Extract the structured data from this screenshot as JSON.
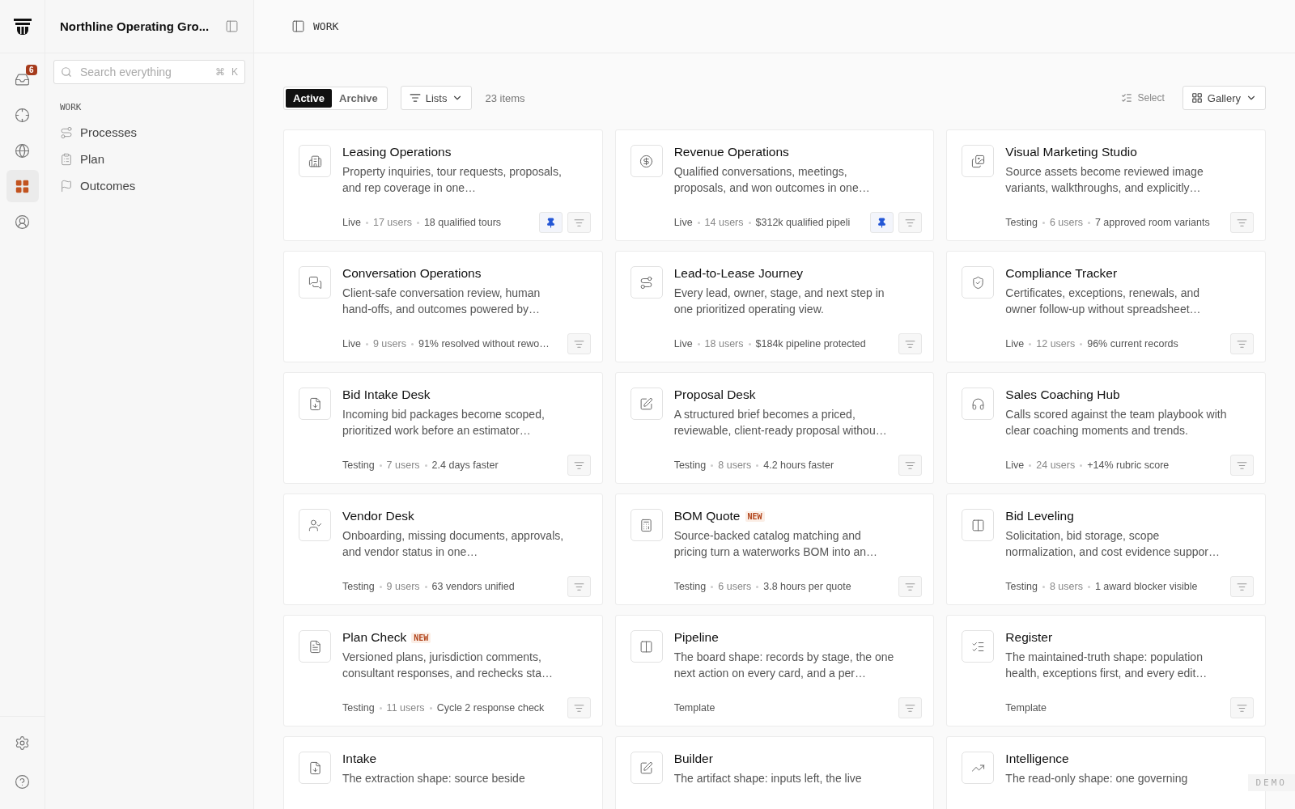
{
  "workspace": {
    "name": "Northline Operating Gro..."
  },
  "rail": {
    "items": [
      {
        "selected": false,
        "badge": "6"
      },
      {
        "selected": false
      },
      {
        "selected": false
      },
      {
        "selected": true
      },
      {
        "selected": false
      }
    ]
  },
  "search": {
    "placeholder": "Search everything",
    "shortcut": [
      "⌘",
      "K"
    ]
  },
  "sidebar": {
    "section": "WORK",
    "items": [
      {
        "label": "Processes"
      },
      {
        "label": "Plan"
      },
      {
        "label": "Outcomes"
      }
    ]
  },
  "header": {
    "title": "WORK"
  },
  "toolbar": {
    "tabs": [
      {
        "label": "Active",
        "selected": true
      },
      {
        "label": "Archive",
        "selected": false
      }
    ],
    "lists": "Lists",
    "count": "23 items",
    "select": "Select",
    "view": "Gallery"
  },
  "cards": [
    {
      "title": "Leasing Operations",
      "description": "Property inquiries, tour requests, proposals, and rep coverage in one…",
      "status": "Live",
      "users": "17 users",
      "metric": "18 qualified tours",
      "pinned": true
    },
    {
      "title": "Revenue Operations",
      "description": "Qualified conversations, meetings, proposals, and won outcomes in one…",
      "status": "Live",
      "users": "14 users",
      "metric": "$312k qualified pipeli",
      "pinned": true
    },
    {
      "title": "Visual Marketing Studio",
      "description": "Source assets become reviewed image variants, walkthroughs, and explicitly…",
      "status": "Testing",
      "users": "6 users",
      "metric": "7 approved room variants",
      "pinned": false
    },
    {
      "title": "Conversation Operations",
      "description": "Client-safe conversation review, human hand-offs, and outcomes powered by…",
      "status": "Live",
      "users": "9 users",
      "metric": "91% resolved without rewo…",
      "pinned": false
    },
    {
      "title": "Lead-to-Lease Journey",
      "description": "Every lead, owner, stage, and next step in one prioritized operating view.",
      "status": "Live",
      "users": "18 users",
      "metric": "$184k pipeline protected",
      "pinned": false
    },
    {
      "title": "Compliance Tracker",
      "description": "Certificates, exceptions, renewals, and owner follow-up without spreadsheet…",
      "status": "Live",
      "users": "12 users",
      "metric": "96% current records",
      "pinned": false
    },
    {
      "title": "Bid Intake Desk",
      "description": "Incoming bid packages become scoped, prioritized work before an estimator…",
      "status": "Testing",
      "users": "7 users",
      "metric": "2.4 days faster",
      "pinned": false
    },
    {
      "title": "Proposal Desk",
      "description": "A structured brief becomes a priced, reviewable, client-ready proposal withou…",
      "status": "Testing",
      "users": "8 users",
      "metric": "4.2 hours faster",
      "pinned": false
    },
    {
      "title": "Sales Coaching Hub",
      "description": "Calls scored against the team playbook with clear coaching moments and trends.",
      "status": "Live",
      "users": "24 users",
      "metric": "+14% rubric score",
      "pinned": false
    },
    {
      "title": "Vendor Desk",
      "description": "Onboarding, missing documents, approvals, and vendor status in one…",
      "status": "Testing",
      "users": "9 users",
      "metric": "63 vendors unified",
      "pinned": false
    },
    {
      "title": "BOM Quote",
      "badge": "NEW",
      "description": "Source-backed catalog matching and pricing turn a waterworks BOM into an…",
      "status": "Testing",
      "users": "6 users",
      "metric": "3.8 hours per quote",
      "pinned": false
    },
    {
      "title": "Bid Leveling",
      "description": "Solicitation, bid storage, scope normalization, and cost evidence suppor…",
      "status": "Testing",
      "users": "8 users",
      "metric": "1 award blocker visible",
      "pinned": false
    },
    {
      "title": "Plan Check",
      "badge": "NEW",
      "description": "Versioned plans, jurisdiction comments, consultant responses, and rechecks sta…",
      "status": "Testing",
      "users": "11 users",
      "metric": "Cycle 2 response check",
      "pinned": false
    },
    {
      "title": "Pipeline",
      "description": "The board shape: records by stage, the one next action on every card, and a per…",
      "status": "Template",
      "pinned": false
    },
    {
      "title": "Register",
      "description": "The maintained-truth shape: population health, exceptions first, and every edit…",
      "status": "Template",
      "pinned": false
    },
    {
      "title": "Intake",
      "description": "The extraction shape: source beside"
    },
    {
      "title": "Builder",
      "description": "The artifact shape: inputs left, the live"
    },
    {
      "title": "Intelligence",
      "description": "The read-only shape: one governing"
    }
  ],
  "demo_badge": "DEMO"
}
